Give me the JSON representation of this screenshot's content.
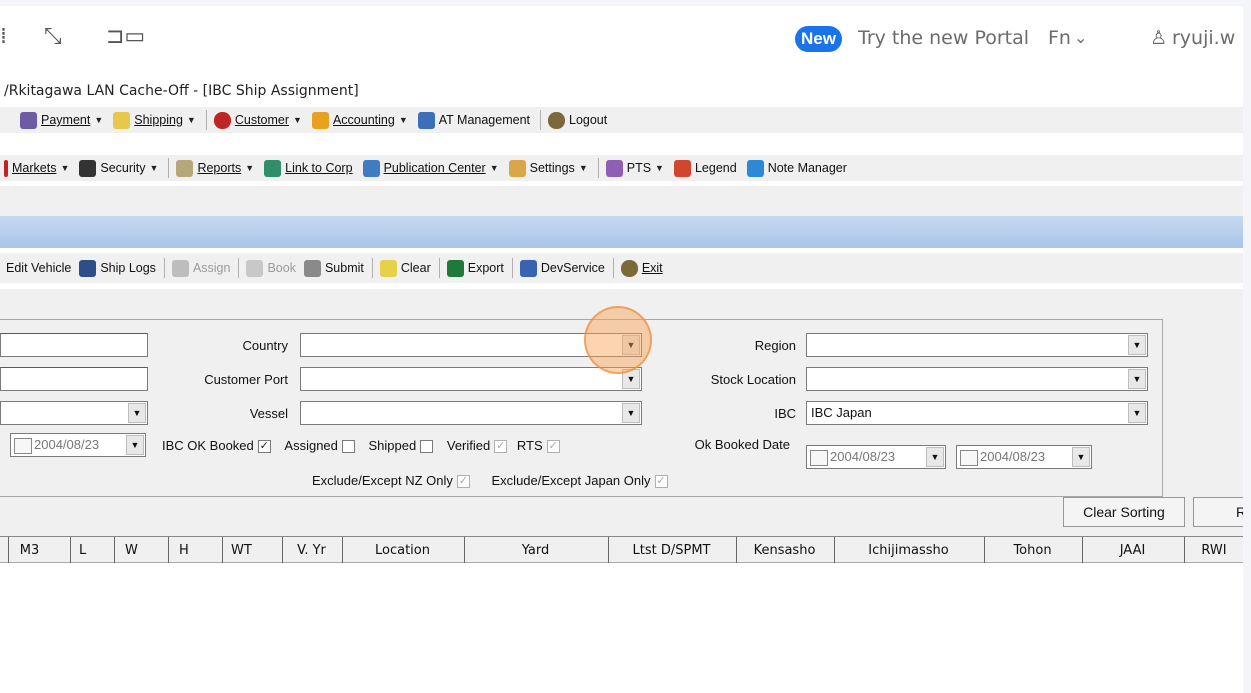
{
  "portal_bar": {
    "new_badge": "New",
    "try_portal": "Try the new Portal",
    "fn_label": "Fn",
    "user_name": "ryuji.w",
    "icons": [
      "expand-icon",
      "monitor-icon",
      "chevron-down-icon",
      "user-icon"
    ]
  },
  "window": {
    "title": "/Rkitagawa LAN Cache-Off - [IBC Ship Assignment]"
  },
  "menu1": [
    {
      "label": "Payment",
      "icon": "payment-icon",
      "dropdown": true
    },
    {
      "label": "Shipping",
      "icon": "shipping-icon",
      "dropdown": true
    },
    {
      "label": "Customer",
      "icon": "customer-icon",
      "dropdown": true
    },
    {
      "label": "Accounting",
      "icon": "accounting-icon",
      "dropdown": true
    },
    {
      "label": "AT Management",
      "icon": "at-management-icon",
      "dropdown": false
    },
    {
      "label": "Logout",
      "icon": "logout-icon",
      "dropdown": false
    }
  ],
  "menu2": [
    {
      "label": "Markets",
      "icon": "markets-icon",
      "dropdown": true
    },
    {
      "label": "Security",
      "icon": "security-icon",
      "dropdown": true
    },
    {
      "label": "Reports",
      "icon": "reports-icon",
      "dropdown": true
    },
    {
      "label": "Link to Corp",
      "icon": "link-icon",
      "dropdown": false
    },
    {
      "label": "Publication Center",
      "icon": "publication-icon",
      "dropdown": true
    },
    {
      "label": "Settings",
      "icon": "settings-icon",
      "dropdown": true
    },
    {
      "label": "PTS",
      "icon": "pts-icon",
      "dropdown": true
    },
    {
      "label": "Legend",
      "icon": "legend-icon",
      "dropdown": false
    },
    {
      "label": "Note Manager",
      "icon": "note-manager-icon",
      "dropdown": false
    }
  ],
  "toolbar": [
    {
      "label": "Edit Vehicle",
      "enabled": true
    },
    {
      "label": "Ship Logs",
      "enabled": true
    },
    {
      "label": "Assign",
      "enabled": false
    },
    {
      "label": "Book",
      "enabled": false
    },
    {
      "label": "Submit",
      "enabled": true
    },
    {
      "label": "Clear",
      "enabled": true
    },
    {
      "label": "Export",
      "enabled": true
    },
    {
      "label": "DevService",
      "enabled": true
    },
    {
      "label": "Exit",
      "enabled": true
    }
  ],
  "filters": {
    "country_label": "Country",
    "country_value": "",
    "customer_port_label": "Customer Port",
    "customer_port_value": "",
    "vessel_label": "Vessel",
    "vessel_value": "",
    "region_label": "Region",
    "region_value": "",
    "stock_location_label": "Stock Location",
    "stock_location_value": "",
    "ibc_label": "IBC",
    "ibc_value": "IBC Japan",
    "date_left": "2004/08/23",
    "ibc_ok_booked_label": "IBC OK Booked",
    "ibc_ok_booked_checked": "✓",
    "assigned_label": "Assigned",
    "shipped_label": "Shipped",
    "verified_label": "Verified",
    "verified_checked": "✓",
    "rts_label": "RTS",
    "rts_checked": "✓",
    "ok_booked_date_label": "Ok Booked Date",
    "ok_booked_date_from": "2004/08/23",
    "ok_booked_date_to": "2004/08/23",
    "exclude_nz_label": "Exclude/Except NZ Only",
    "exclude_nz_checked": "✓",
    "exclude_japan_label": "Exclude/Except Japan Only",
    "exclude_japan_checked": "✓"
  },
  "buttons": {
    "clear_sorting": "Clear Sorting",
    "r_partial": "R"
  },
  "grid": {
    "columns": [
      "M3",
      "L",
      "W",
      "H",
      "WT",
      "V. Yr",
      "Location",
      "Yard",
      "Ltst D/SPMT",
      "Kensasho",
      "Ichijimassho",
      "Tohon",
      "JAAI",
      "RWI"
    ]
  }
}
